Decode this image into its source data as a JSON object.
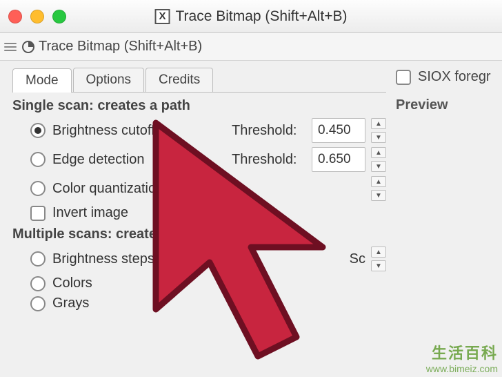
{
  "window": {
    "title": "Trace Bitmap (Shift+Alt+B)",
    "doc_glyph": "X"
  },
  "subheader": {
    "title": "Trace Bitmap (Shift+Alt+B)"
  },
  "tabs": {
    "mode": "Mode",
    "options": "Options",
    "credits": "Credits"
  },
  "panel": {
    "single_heading": "Single scan: creates a path",
    "brightness_cutoff": "Brightness cutoff",
    "edge_detection": "Edge detection",
    "color_quantization": "Color quantization",
    "invert_image": "Invert image",
    "multiple_heading": "Multiple scans: creates a",
    "brightness_steps": "Brightness steps",
    "multiple_scans_label_fragment": "Sc",
    "colors": "Colors",
    "grays": "Grays",
    "threshold_label": "Threshold:",
    "brightness_threshold_value": "0.450",
    "edge_threshold_value": "0.650"
  },
  "right": {
    "siox_label": "SIOX foregr",
    "preview_label": "Preview"
  },
  "watermark": {
    "cn": "生活百科",
    "url": "www.bimeiz.com"
  }
}
